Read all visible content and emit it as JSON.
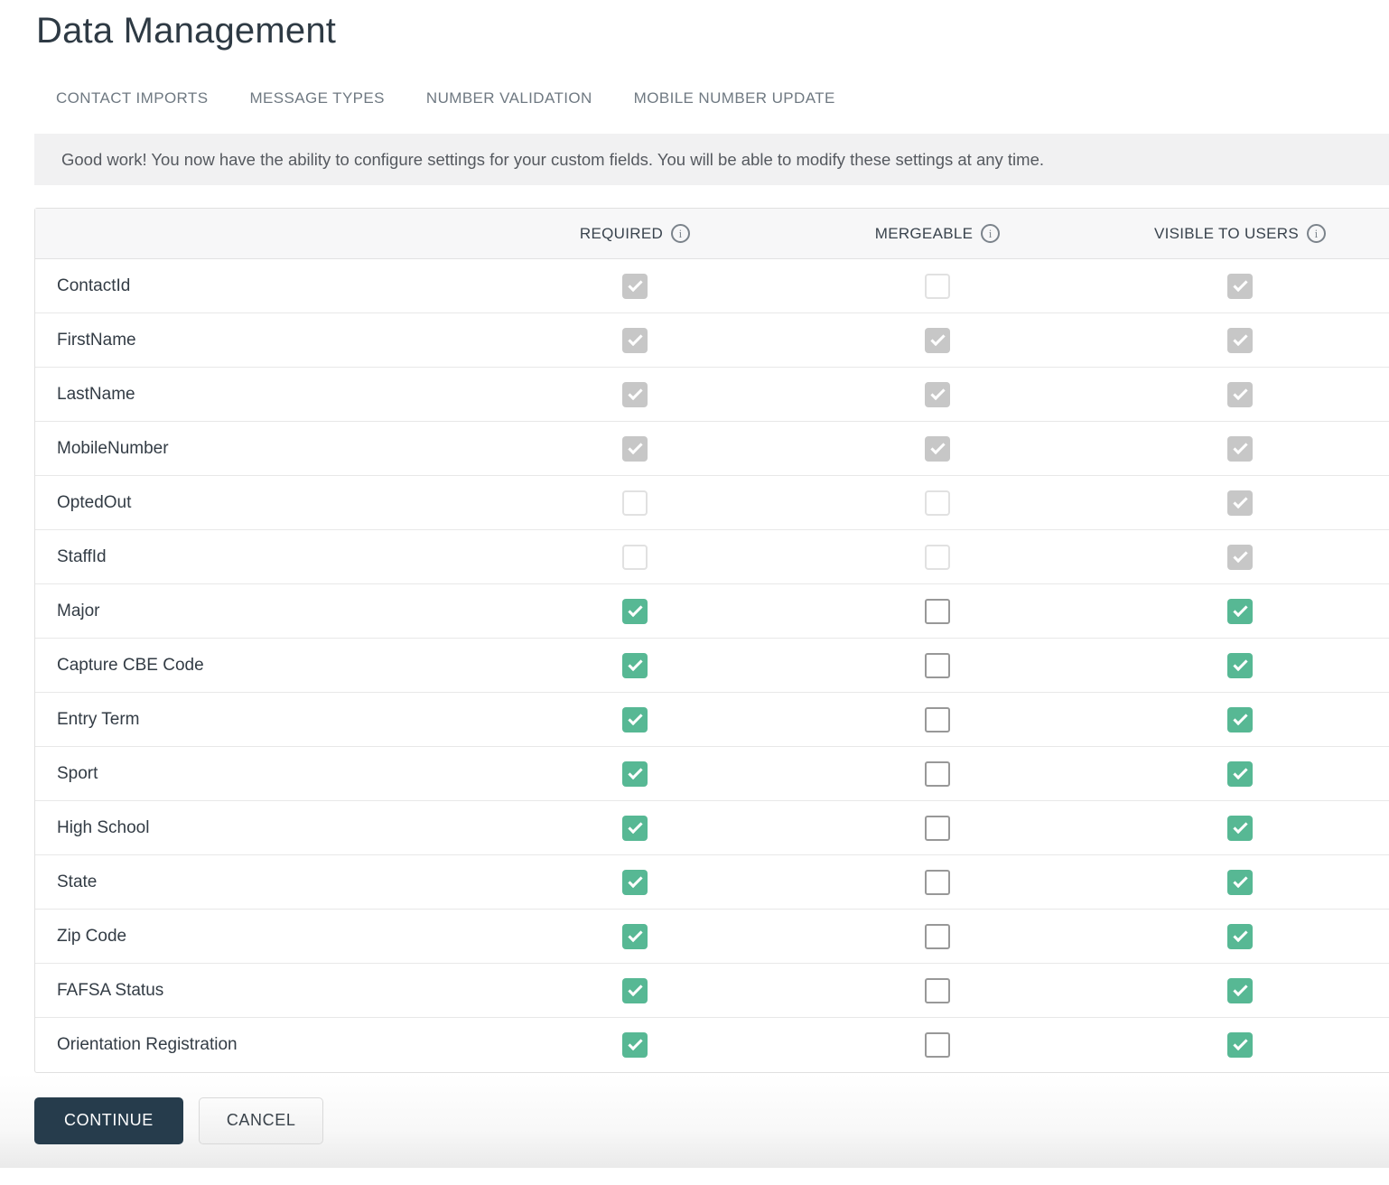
{
  "page": {
    "title": "Data Management"
  },
  "tabs": [
    {
      "label": "CONTACT IMPORTS"
    },
    {
      "label": "MESSAGE TYPES"
    },
    {
      "label": "NUMBER VALIDATION"
    },
    {
      "label": "MOBILE NUMBER UPDATE"
    }
  ],
  "banner": {
    "text": "Good work! You now have the ability to configure settings for your custom fields. You will be able to modify these settings at any time."
  },
  "icons": {
    "info": "i"
  },
  "colors": {
    "accent_green": "#57b894",
    "disabled_checked_gray": "#c7c7c7",
    "continue_button_bg": "#263c4c",
    "header_bg": "#f7f7f8",
    "banner_bg": "#f1f1f2"
  },
  "table": {
    "columns": [
      {
        "label": "REQUIRED",
        "icon": "info-icon"
      },
      {
        "label": "MERGEABLE",
        "icon": "info-icon"
      },
      {
        "label": "VISIBLE TO USERS",
        "icon": "info-icon"
      }
    ],
    "rows": [
      {
        "name": "ContactId",
        "required": {
          "checked": true,
          "disabled": true
        },
        "mergeable": {
          "checked": false,
          "disabled": true
        },
        "visible": {
          "checked": true,
          "disabled": true
        }
      },
      {
        "name": "FirstName",
        "required": {
          "checked": true,
          "disabled": true
        },
        "mergeable": {
          "checked": true,
          "disabled": true
        },
        "visible": {
          "checked": true,
          "disabled": true
        }
      },
      {
        "name": "LastName",
        "required": {
          "checked": true,
          "disabled": true
        },
        "mergeable": {
          "checked": true,
          "disabled": true
        },
        "visible": {
          "checked": true,
          "disabled": true
        }
      },
      {
        "name": "MobileNumber",
        "required": {
          "checked": true,
          "disabled": true
        },
        "mergeable": {
          "checked": true,
          "disabled": true
        },
        "visible": {
          "checked": true,
          "disabled": true
        }
      },
      {
        "name": "OptedOut",
        "required": {
          "checked": false,
          "disabled": true
        },
        "mergeable": {
          "checked": false,
          "disabled": true
        },
        "visible": {
          "checked": true,
          "disabled": true
        }
      },
      {
        "name": "StaffId",
        "required": {
          "checked": false,
          "disabled": true
        },
        "mergeable": {
          "checked": false,
          "disabled": true
        },
        "visible": {
          "checked": true,
          "disabled": true
        }
      },
      {
        "name": "Major",
        "required": {
          "checked": true,
          "disabled": false
        },
        "mergeable": {
          "checked": false,
          "disabled": false
        },
        "visible": {
          "checked": true,
          "disabled": false
        }
      },
      {
        "name": "Capture CBE Code",
        "required": {
          "checked": true,
          "disabled": false
        },
        "mergeable": {
          "checked": false,
          "disabled": false
        },
        "visible": {
          "checked": true,
          "disabled": false
        }
      },
      {
        "name": "Entry Term",
        "required": {
          "checked": true,
          "disabled": false
        },
        "mergeable": {
          "checked": false,
          "disabled": false
        },
        "visible": {
          "checked": true,
          "disabled": false
        }
      },
      {
        "name": "Sport",
        "required": {
          "checked": true,
          "disabled": false
        },
        "mergeable": {
          "checked": false,
          "disabled": false
        },
        "visible": {
          "checked": true,
          "disabled": false
        }
      },
      {
        "name": "High School",
        "required": {
          "checked": true,
          "disabled": false
        },
        "mergeable": {
          "checked": false,
          "disabled": false
        },
        "visible": {
          "checked": true,
          "disabled": false
        }
      },
      {
        "name": "State",
        "required": {
          "checked": true,
          "disabled": false
        },
        "mergeable": {
          "checked": false,
          "disabled": false
        },
        "visible": {
          "checked": true,
          "disabled": false
        }
      },
      {
        "name": "Zip Code",
        "required": {
          "checked": true,
          "disabled": false
        },
        "mergeable": {
          "checked": false,
          "disabled": false
        },
        "visible": {
          "checked": true,
          "disabled": false
        }
      },
      {
        "name": "FAFSA Status",
        "required": {
          "checked": true,
          "disabled": false
        },
        "mergeable": {
          "checked": false,
          "disabled": false
        },
        "visible": {
          "checked": true,
          "disabled": false
        }
      },
      {
        "name": "Orientation Registration",
        "required": {
          "checked": true,
          "disabled": false
        },
        "mergeable": {
          "checked": false,
          "disabled": false
        },
        "visible": {
          "checked": true,
          "disabled": false
        }
      }
    ]
  },
  "actions": {
    "continue_label": "CONTINUE",
    "cancel_label": "CANCEL"
  }
}
